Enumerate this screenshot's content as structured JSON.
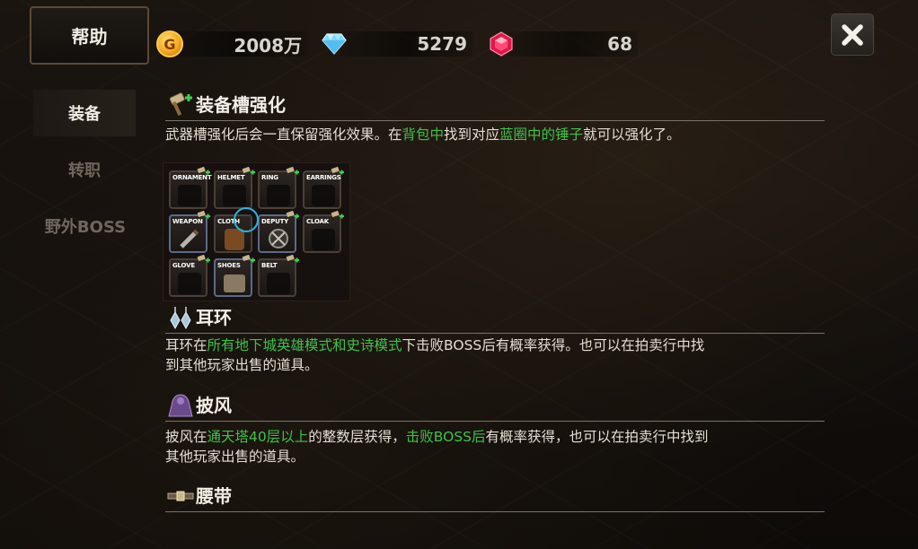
{
  "help_tab": {
    "label": "帮助"
  },
  "currency": {
    "gold": "2008万",
    "diamond": "5279",
    "ruby": "68"
  },
  "gold_icon_glyph": "G",
  "close_icon": "close-icon",
  "side_tabs": [
    {
      "label": "装备",
      "active": true
    },
    {
      "label": "转职",
      "active": false
    },
    {
      "label": "野外BOSS",
      "active": false
    }
  ],
  "sections": {
    "slot_upgrade": {
      "title": "装备槽强化",
      "text_1": "武器槽强化后会一直保留强化效果。在",
      "text_hl_1": "背包中",
      "text_2": "找到对应",
      "text_hl_2": "蓝圈中的锤子",
      "text_3": "就可以强化了。"
    },
    "earrings": {
      "title": "耳环",
      "text_1": "耳环在",
      "text_hl_1": "所有地下城英雄模式和史诗模式",
      "text_2": "下击败BOSS后有概率获得。也可以在拍卖行中找",
      "text_3": "到其他玩家出售的道具。"
    },
    "cloak": {
      "title": "披风",
      "text_1": "披风在",
      "text_hl_1": "通天塔40层以上",
      "text_2": "的整数层获得，",
      "text_hl_2": "击败BOSS后",
      "text_3": "有概率获得，也可以在拍卖行中找到",
      "text_4": "其他玩家出售的道具。"
    },
    "belt": {
      "title": "腰带"
    }
  },
  "equip_slots": [
    "ORNAMENT",
    "HELMET",
    "RING",
    "EARRINGS",
    "WEAPON",
    "CLOTH",
    "DEPUTY",
    "CLOAK",
    "GLOVE",
    "SHOES",
    "BELT"
  ],
  "colors": {
    "highlight": "#3fc24a",
    "ring": "#2bb5e0",
    "plus": "#3ad24a"
  }
}
